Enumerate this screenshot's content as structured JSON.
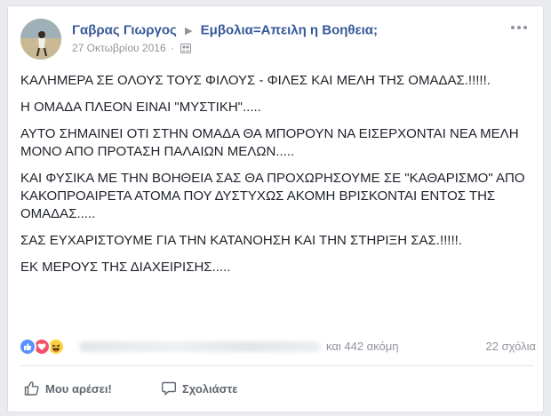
{
  "post": {
    "author": "Γαβρας Γιωργος",
    "group": "Εμβολια=Απειλη η Βοηθεια;",
    "date": "27 Οκτωβρίου 2016",
    "separator": "·",
    "audience_icon": "group-icon",
    "paragraphs": [
      "ΚΑΛΗΜΕΡΑ ΣΕ ΟΛΟΥΣ ΤΟΥΣ ΦΙΛΟΥΣ - ΦΙΛΕΣ ΚΑΙ ΜΕΛΗ ΤΗΣ ΟΜΑΔΑΣ.!!!!!.",
      "Η ΟΜΑΔΑ ΠΛΕΟΝ ΕΙΝΑΙ \"ΜΥΣΤΙΚΗ\".....",
      "ΑΥΤΟ ΣΗΜΑΙΝΕΙ ΟΤΙ ΣΤΗΝ ΟΜΑΔΑ ΘΑ ΜΠΟΡΟΥΝ ΝΑ ΕΙΣΕΡΧΟΝΤΑΙ ΝΕΑ ΜΕΛΗ ΜΟΝΟ ΑΠΟ ΠΡΟΤΑΣΗ ΠΑΛΑΙΩΝ ΜΕΛΩΝ.....",
      "ΚΑΙ ΦΥΣΙΚΑ ΜΕ ΤΗΝ ΒΟΗΘΕΙΑ ΣΑΣ ΘΑ ΠΡΟΧΩΡΗΣΟΥΜΕ ΣΕ \"ΚΑΘΑΡΙΣΜΟ\" ΑΠΟ ΚΑΚΟΠΡΟΑΙΡΕΤΑ ΑΤΟΜΑ ΠΟΥ ΔΥΣΤΥΧΩΣ ΑΚΟΜΗ ΒΡΙΣΚΟΝΤΑΙ ΕΝΤΟΣ ΤΗΣ ΟΜΑΔΑΣ.....",
      "ΣΑΣ ΕΥΧΑΡΙΣΤΟΥΜΕ ΓΙΑ ΤΗΝ ΚΑΤΑΝΟΗΣΗ ΚΑΙ ΤΗΝ ΣΤΗΡΙΞΗ ΣΑΣ.!!!!!.",
      "ΕΚ ΜΕΡΟΥΣ ΤΗΣ ΔΙΑΧΕΙΡΙΣΗΣ....."
    ]
  },
  "reactions": {
    "icons": [
      "like-icon",
      "love-icon",
      "haha-icon"
    ],
    "others": "και 442 ακόμη",
    "comments": "22 σχόλια"
  },
  "actions": {
    "like_label": "Μου αρέσει!",
    "comment_label": "Σχολιάστε"
  },
  "colors": {
    "link": "#365899",
    "meta": "#90949c",
    "like": "#5890ff",
    "love": "#f25268",
    "haha": "#fcd240"
  }
}
